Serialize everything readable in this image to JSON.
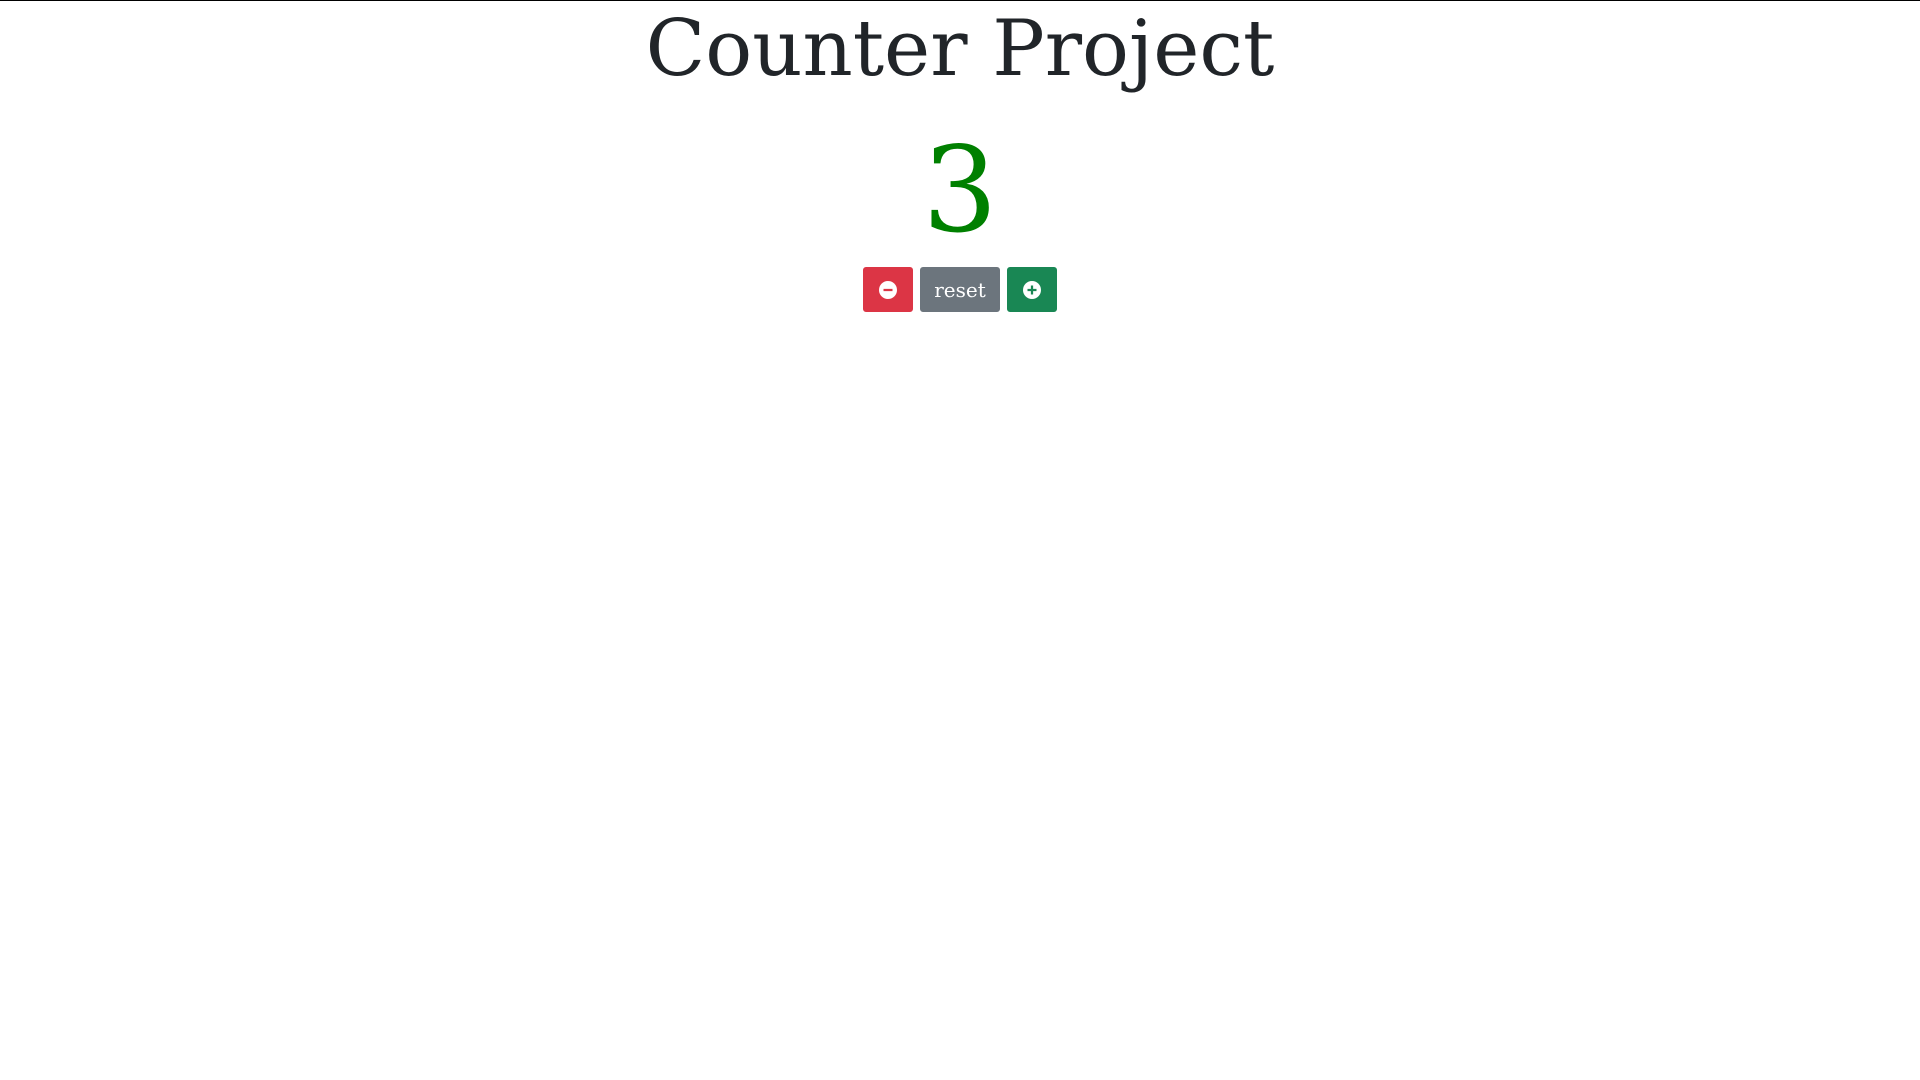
{
  "page": {
    "title": "Counter Project"
  },
  "counter": {
    "value": "3",
    "value_color": "#008000"
  },
  "controls": {
    "decrement": {
      "icon": "minus-circle-icon",
      "color": "#dc3545"
    },
    "reset": {
      "label": "reset",
      "color": "#6c757d"
    },
    "increment": {
      "icon": "plus-circle-icon",
      "color": "#198754"
    }
  }
}
